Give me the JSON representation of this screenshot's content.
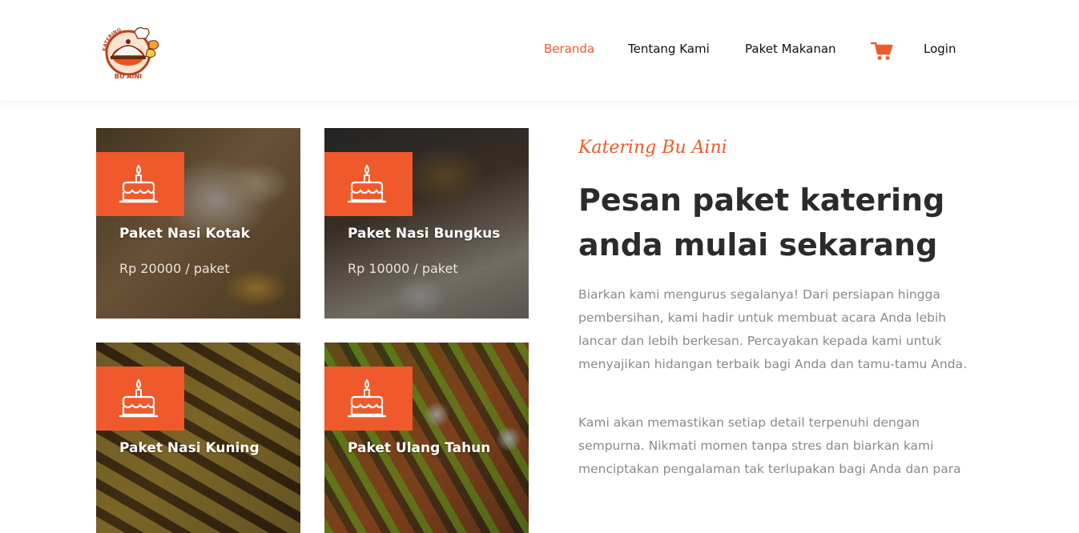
{
  "brand": {
    "logo_arc_text": "KATERING",
    "logo_bottom_text": "BU AINI",
    "accent_color": "#f15a2b"
  },
  "nav": {
    "items": [
      {
        "label": "Beranda",
        "active": true
      },
      {
        "label": "Tentang Kami",
        "active": false
      },
      {
        "label": "Paket Makanan",
        "active": false
      },
      {
        "label": "Login",
        "active": false
      }
    ],
    "cart_icon": "shopping-cart-icon"
  },
  "packages": [
    {
      "title": "Paket Nasi Kotak",
      "price": "Rp 20000 / paket",
      "icon": "birthday-cake-icon"
    },
    {
      "title": "Paket Nasi Bungkus",
      "price": "Rp 10000 / paket",
      "icon": "birthday-cake-icon"
    },
    {
      "title": "Paket Nasi Kuning",
      "price": "",
      "icon": "birthday-cake-icon"
    },
    {
      "title": "Paket Ulang Tahun",
      "price": "",
      "icon": "birthday-cake-icon"
    }
  ],
  "hero": {
    "kicker": "Katering Bu Aini",
    "headline": "Pesan paket katering anda mulai sekarang",
    "paragraph1": "Biarkan kami mengurus segalanya! Dari persiapan hingga pembersihan, kami hadir untuk membuat acara Anda lebih lancar dan lebih berkesan. Percayakan kepada kami untuk menyajikan hidangan terbaik bagi Anda dan tamu-tamu Anda.",
    "paragraph2": "Kami akan memastikan setiap detail terpenuhi dengan sempurna. Nikmati momen tanpa stres dan biarkan kami menciptakan pengalaman tak terlupakan bagi Anda dan para"
  }
}
